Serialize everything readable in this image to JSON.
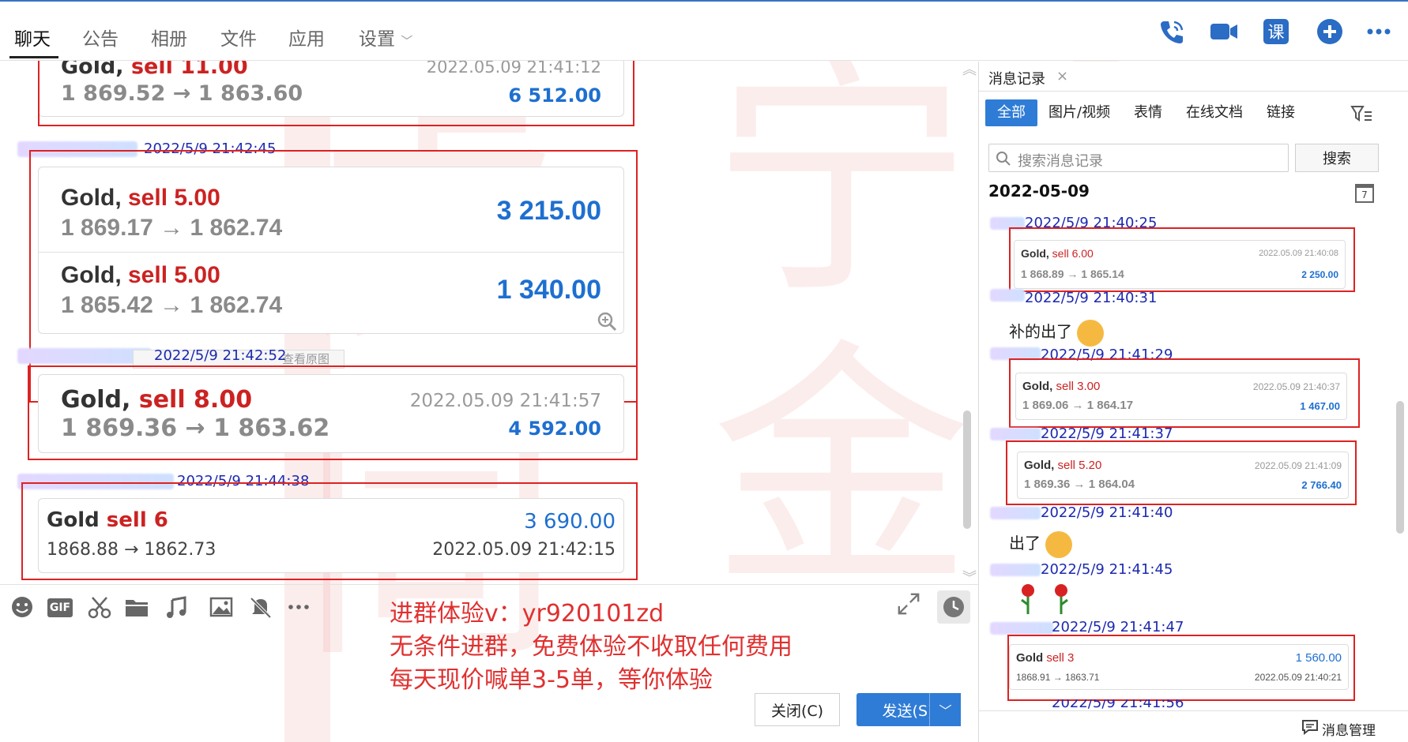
{
  "tabs": [
    {
      "label": "聊天",
      "active": true
    },
    {
      "label": "公告"
    },
    {
      "label": "相册"
    },
    {
      "label": "文件"
    },
    {
      "label": "应用"
    },
    {
      "label": "设置",
      "has_dropdown": true
    }
  ],
  "toolbar_icons": [
    "phone-icon",
    "video-icon",
    "course-icon",
    "add-icon",
    "more-icon"
  ],
  "toolbar_course_glyph": "课",
  "chat": {
    "messages": [
      {
        "timestamp": "",
        "cards": [
          {
            "symbol": "Gold,",
            "side": "sell 11.00",
            "prices": "1 869.52 → 1 863.60",
            "datetime": "2022.05.09 21:41:12",
            "profit": "6 512.00"
          }
        ]
      },
      {
        "timestamp": "2022/5/9 21:42:45",
        "cards": [
          {
            "symbol": "Gold,",
            "side": "sell 5.00",
            "prices": "1 869.17 → 1 862.74",
            "profit": "3 215.00"
          },
          {
            "symbol": "Gold,",
            "side": "sell 5.00",
            "prices": "1 865.42 → 1 862.74",
            "profit": "1 340.00"
          }
        ]
      },
      {
        "timestamp": "2022/5/9 21:42:52",
        "overlay_text": "查看原图",
        "cards": [
          {
            "symbol": "Gold,",
            "side": "sell 8.00",
            "prices": "1 869.36 → 1 863.62",
            "datetime": "2022.05.09 21:41:57",
            "profit": "4 592.00"
          }
        ]
      },
      {
        "timestamp": "2022/5/9 21:44:38",
        "cards": [
          {
            "symbol": "Gold",
            "side": "sell 6",
            "prices": "1868.88 → 1862.73",
            "datetime": "2022.05.09 21:42:15",
            "profit": "3 690.00"
          }
        ]
      }
    ]
  },
  "input_toolbar_icons": [
    "emoji-icon",
    "gif-icon",
    "scissors-icon",
    "folder-icon",
    "music-icon",
    "image-icon",
    "mute-bell-icon",
    "more-icon"
  ],
  "gif_label": "GIF",
  "promo": [
    "进群体验v：yr920101zd",
    "无条件进群，免费体验不收取任何费用",
    "每天现价喊单3-5单，等你体验"
  ],
  "buttons": {
    "close": "关闭(C)",
    "send": "发送(S)"
  },
  "side": {
    "title": "消息记录",
    "filters": [
      {
        "label": "全部",
        "active": true
      },
      {
        "label": "图片/视频"
      },
      {
        "label": "表情"
      },
      {
        "label": "在线文档"
      },
      {
        "label": "链接"
      }
    ],
    "search_placeholder": "搜索消息记录",
    "search_button": "搜索",
    "date": "2022-05-09",
    "calendar_day": "7",
    "records": [
      {
        "timestamp": "2022/5/9 21:40:25",
        "card": {
          "symbol": "Gold,",
          "side": "sell 6.00",
          "prices": "1 868.89 → 1 865.14",
          "datetime": "2022.05.09 21:40:08",
          "profit": "2 250.00"
        }
      },
      {
        "timestamp": "2022/5/9 21:40:31",
        "text": "补的出了"
      },
      {
        "timestamp": "2022/5/9 21:41:29",
        "card": {
          "symbol": "Gold,",
          "side": "sell 3.00",
          "prices": "1 869.06 → 1 864.17",
          "datetime": "2022.05.09 21:40:37",
          "profit": "1 467.00"
        }
      },
      {
        "timestamp": "2022/5/9 21:41:37",
        "card": {
          "symbol": "Gold,",
          "side": "sell 5.20",
          "prices": "1 869.36 → 1 864.04",
          "datetime": "2022.05.09 21:41:09",
          "profit": "2 766.40"
        }
      },
      {
        "timestamp": "2022/5/9 21:41:40",
        "text": "出了"
      },
      {
        "timestamp": "2022/5/9 21:41:45"
      },
      {
        "timestamp": "2022/5/9 21:41:47",
        "card": {
          "symbol": "Gold",
          "side": "sell 3",
          "prices": "1868.91 → 1863.71",
          "datetime": "2022.05.09 21:40:21",
          "profit": "1 560.00"
        }
      },
      {
        "timestamp": "2022/5/9 21:41:56"
      }
    ],
    "manage_label": "消息管理"
  },
  "watermark": [
    "虎",
    "宁",
    "金",
    "同"
  ],
  "colors": {
    "accent_blue": "#2f7cd6",
    "sell_red": "#cc2222",
    "profit_blue": "#1e6fd0",
    "timestamp_blue": "#1c2ab0",
    "annotation_red": "#dd2222"
  }
}
